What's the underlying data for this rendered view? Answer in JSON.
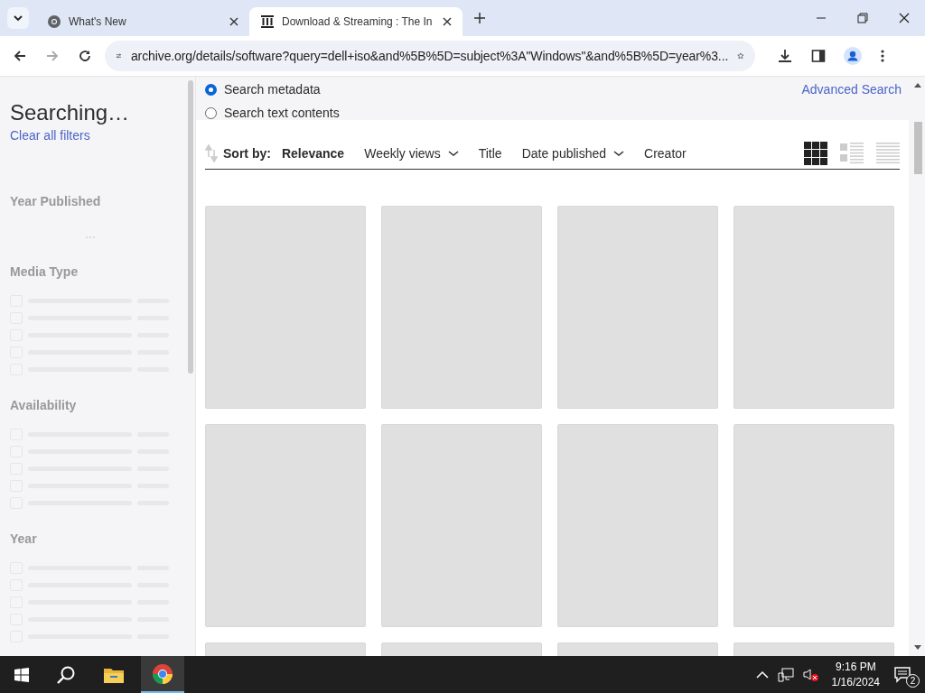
{
  "browser": {
    "tabs": [
      {
        "title": "What's New",
        "selected": false
      },
      {
        "title": "Download & Streaming : The In",
        "selected": true
      }
    ],
    "address": "archive.org/details/software?query=dell+iso&and%5B%5D=subject%3A\"Windows\"&and%5B%5D=year%3..."
  },
  "sidebar": {
    "title": "Searching…",
    "clear_link": "Clear all filters",
    "facets": [
      {
        "title": "Year Published",
        "kind": "histogram"
      },
      {
        "title": "Media Type",
        "kind": "list"
      },
      {
        "title": "Availability",
        "kind": "list"
      },
      {
        "title": "Year",
        "kind": "list"
      }
    ]
  },
  "search_options": [
    {
      "label": "Search metadata",
      "selected": true
    },
    {
      "label": "Search text contents",
      "selected": false
    }
  ],
  "advanced_search": "Advanced Search",
  "sort": {
    "label": "Sort by:",
    "options": [
      {
        "label": "Relevance",
        "selected": true,
        "dropdown": false
      },
      {
        "label": "Weekly views",
        "selected": false,
        "dropdown": true
      },
      {
        "label": "Title",
        "selected": false,
        "dropdown": false
      },
      {
        "label": "Date published",
        "selected": false,
        "dropdown": true
      },
      {
        "label": "Creator",
        "selected": false,
        "dropdown": false
      }
    ]
  },
  "view_modes": [
    {
      "kind": "tiles",
      "selected": true
    },
    {
      "kind": "list-detail",
      "selected": false
    },
    {
      "kind": "list-compact",
      "selected": false
    }
  ],
  "taskbar": {
    "time": "9:16 PM",
    "date": "1/16/2024",
    "notifications": "2"
  }
}
